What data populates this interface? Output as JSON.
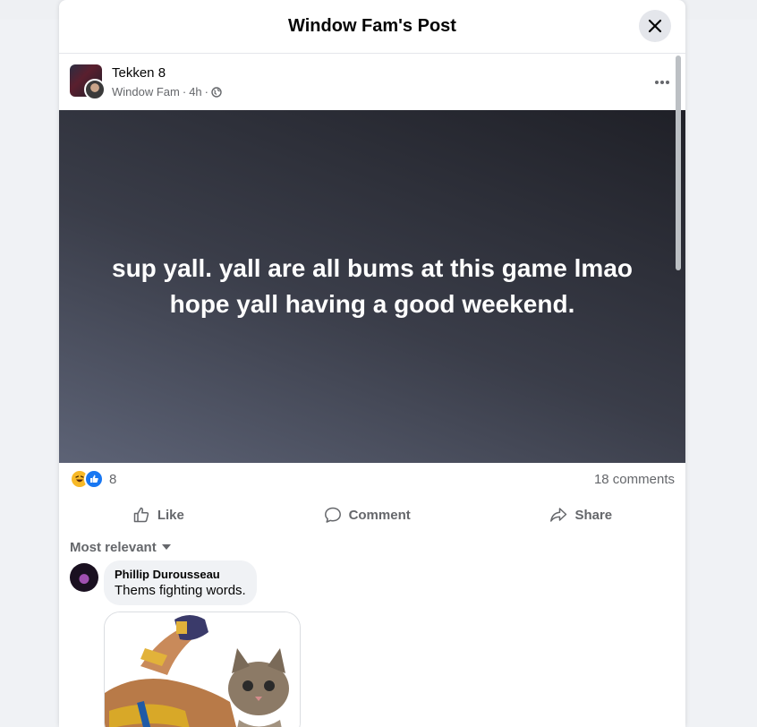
{
  "modal": {
    "title": "Window Fam's Post"
  },
  "post": {
    "group_name": "Tekken 8",
    "author": "Window Fam",
    "time": "4h",
    "separator": "·",
    "text": "sup yall. yall are all bums at this game lmao hope yall having a good weekend.",
    "background_colors": [
      "#5d6376",
      "#3a3d49",
      "#1f2027"
    ]
  },
  "reactions": {
    "types": [
      "haha",
      "like"
    ],
    "count": "8",
    "comments_count": "18 comments"
  },
  "actions": {
    "like": "Like",
    "comment": "Comment",
    "share": "Share"
  },
  "comments": {
    "sort_label": "Most relevant",
    "items": [
      {
        "author": "Phillip Durousseau",
        "text": "Thems fighting words."
      }
    ]
  },
  "colors": {
    "accent": "#1877f2",
    "text_primary": "#050505",
    "text_secondary": "#65676b",
    "haha": "#f7b928"
  }
}
